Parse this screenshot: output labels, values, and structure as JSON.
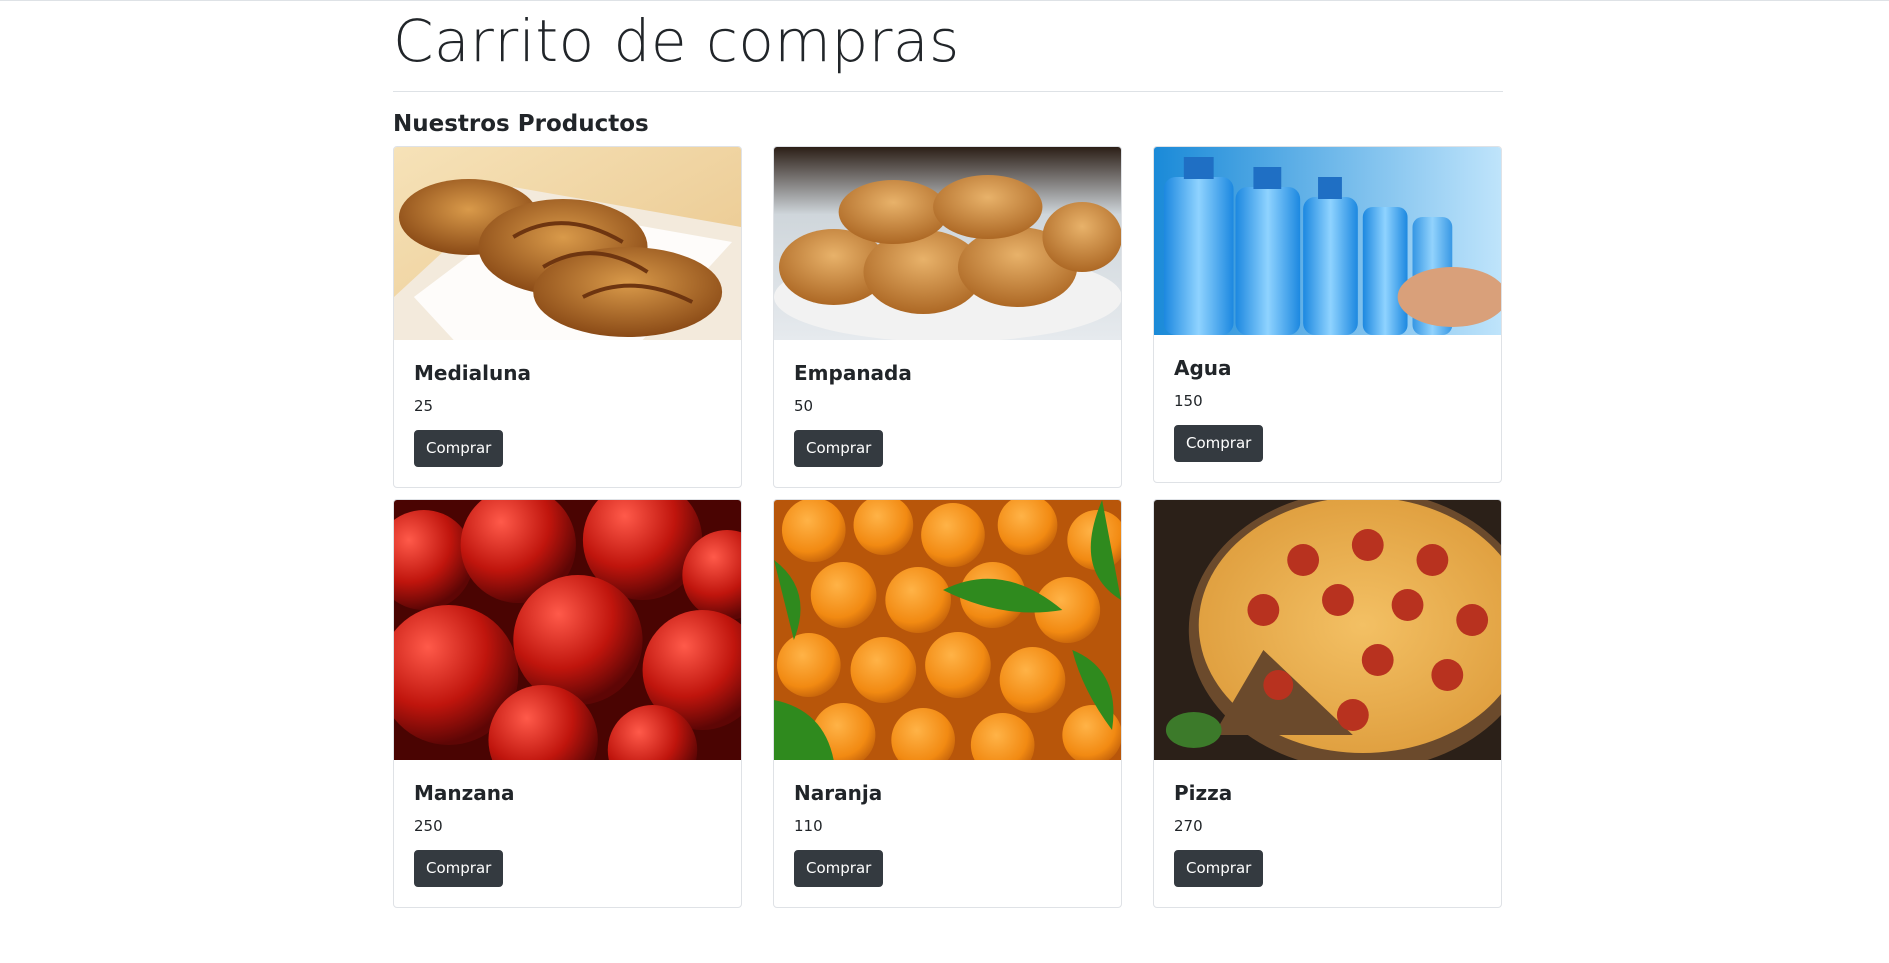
{
  "header": {
    "title": "Carrito de compras",
    "section_title": "Nuestros Productos"
  },
  "products": [
    {
      "name": "Medialuna",
      "price": "25",
      "button": "Comprar",
      "image": "croissant-image"
    },
    {
      "name": "Empanada",
      "price": "50",
      "button": "Comprar",
      "image": "empanada-image"
    },
    {
      "name": "Agua",
      "price": "150",
      "button": "Comprar",
      "image": "water-bottles-image"
    },
    {
      "name": "Manzana",
      "price": "250",
      "button": "Comprar",
      "image": "apples-image"
    },
    {
      "name": "Naranja",
      "price": "110",
      "button": "Comprar",
      "image": "oranges-image"
    },
    {
      "name": "Pizza",
      "price": "270",
      "button": "Comprar",
      "image": "pizza-image"
    }
  ],
  "colors": {
    "button_bg": "#343a40",
    "button_text": "#ffffff",
    "border": "#dfe2e6"
  }
}
